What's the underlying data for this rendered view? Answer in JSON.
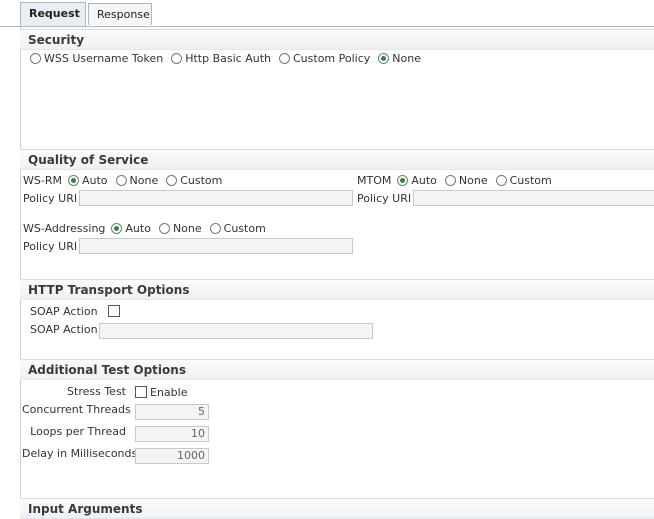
{
  "tabs": [
    {
      "label": "Request",
      "active": true
    },
    {
      "label": "Response",
      "active": false
    }
  ],
  "security": {
    "title": "Security",
    "options": [
      "WSS Username Token",
      "Http Basic Auth",
      "Custom Policy",
      "None"
    ],
    "selected": "None"
  },
  "qos": {
    "title": "Quality of Service",
    "wsrm": {
      "label": "WS-RM",
      "options": [
        "Auto",
        "None",
        "Custom"
      ],
      "selected": "Auto",
      "policy_label": "Policy URI",
      "policy_value": ""
    },
    "mtom": {
      "label": "MTOM",
      "options": [
        "Auto",
        "None",
        "Custom"
      ],
      "selected": "Auto",
      "policy_label": "Policy URI",
      "policy_value": ""
    },
    "wsaddr": {
      "label": "WS-Addressing",
      "options": [
        "Auto",
        "None",
        "Custom"
      ],
      "selected": "Auto",
      "policy_label": "Policy URI",
      "policy_value": ""
    }
  },
  "http": {
    "title": "HTTP Transport Options",
    "soap_checkbox_label": "SOAP Action",
    "soap_checked": false,
    "soap_field_label": "SOAP Action",
    "soap_value": ""
  },
  "additional": {
    "title": "Additional Test Options",
    "stress_label": "Stress Test",
    "enable_label": "Enable",
    "enable_checked": false,
    "threads_label": "Concurrent Threads",
    "threads_value": "5",
    "loops_label": "Loops per Thread",
    "loops_value": "10",
    "delay_label": "Delay in Milliseconds",
    "delay_value": "1000"
  },
  "input": {
    "title": "Input Arguments"
  }
}
